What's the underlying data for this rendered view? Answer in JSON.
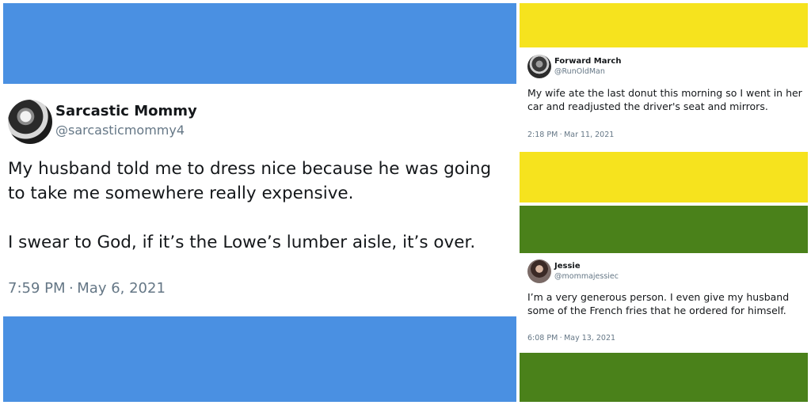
{
  "colors": {
    "blue": "#4a90e2",
    "yellow": "#f6e31e",
    "green": "#4a811a",
    "text": "#14171a",
    "muted": "#657786"
  },
  "tweets": [
    {
      "name": "Sarcastic Mommy",
      "handle": "@sarcasticmommy4",
      "text": [
        "My husband told me to dress nice because he was going to take me somewhere really expensive.",
        "I swear to God, if it’s the Lowe’s lumber aisle, it’s over."
      ],
      "time": "7:59 PM",
      "date": "May 6, 2021",
      "avatar_icon": "profile-photo"
    },
    {
      "name": "Forward March",
      "handle": "@RunOldMan",
      "text": [
        "My wife ate the last donut this morning so I went in her car and readjusted the driver's seat and mirrors."
      ],
      "time": "2:18 PM",
      "date": "Mar 11, 2021",
      "avatar_icon": "profile-photo"
    },
    {
      "name": "Jessie",
      "handle": "@mommajessiec",
      "text": [
        "I’m a very generous person. I even give my husband some of the French fries that he ordered for himself."
      ],
      "time": "6:08 PM",
      "date": "May 13, 2021",
      "avatar_icon": "profile-photo"
    }
  ],
  "separator": "·"
}
